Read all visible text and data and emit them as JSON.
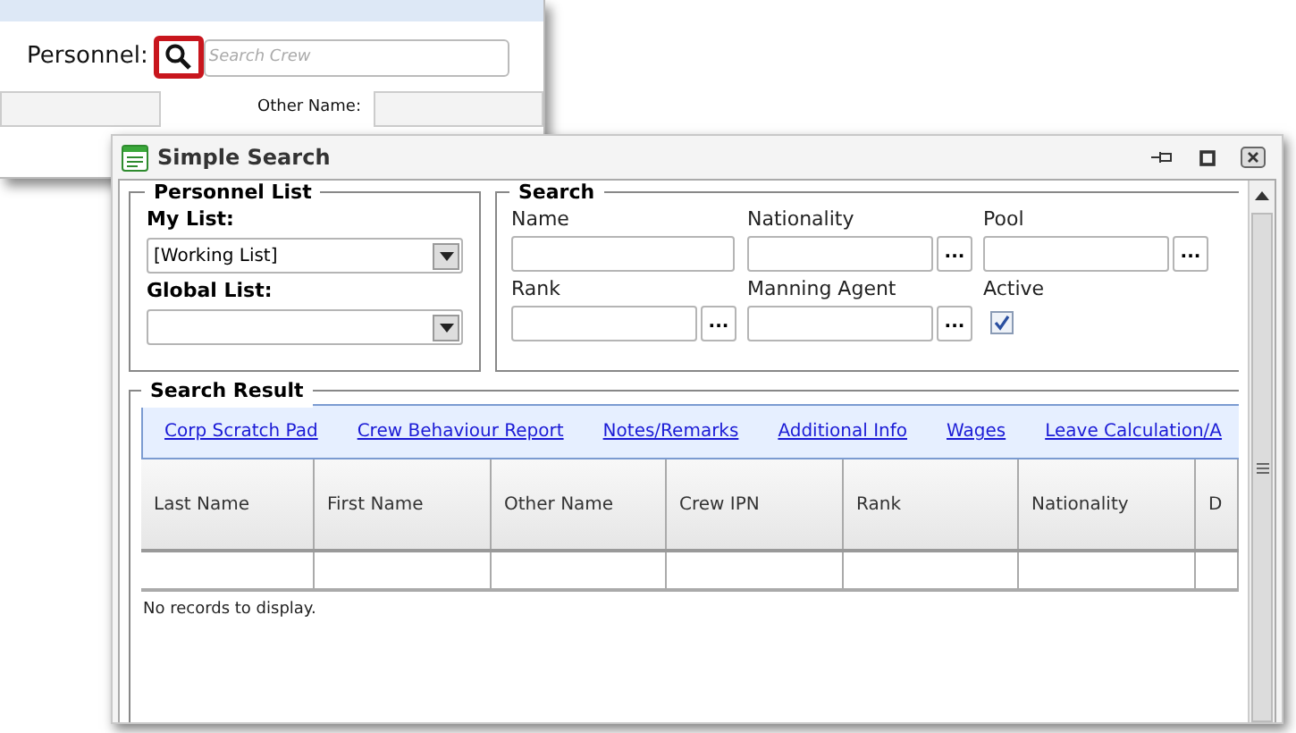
{
  "background_window": {
    "personnel_label": "Personnel:",
    "search_placeholder": "Search Crew",
    "other_name_label": "Other Name:"
  },
  "dialog": {
    "title": "Simple Search",
    "personnel_list": {
      "legend": "Personnel List",
      "my_list_label": "My List:",
      "my_list_value": "[Working List]",
      "global_list_label": "Global List:"
    },
    "search": {
      "legend": "Search",
      "fields": [
        {
          "label": "Name",
          "kind": "text"
        },
        {
          "label": "Nationality",
          "kind": "lookup",
          "button": "..."
        },
        {
          "label": "Pool",
          "kind": "lookup",
          "button": "..."
        },
        {
          "label": "Rank",
          "kind": "lookup",
          "button": "..."
        },
        {
          "label": "Manning Agent",
          "kind": "lookup",
          "button": "..."
        },
        {
          "label": "Active",
          "kind": "checkbox",
          "checked": true
        }
      ]
    },
    "search_result": {
      "legend": "Search Result",
      "links": [
        "Corp Scratch Pad",
        "Crew Behaviour Report",
        "Notes/Remarks",
        "Additional Info",
        "Wages",
        "Leave Calculation/A"
      ],
      "columns": [
        "Last Name",
        "First Name",
        "Other Name",
        "Crew IPN",
        "Rank",
        "Nationality",
        "D"
      ],
      "empty_message": "No records to display."
    }
  }
}
